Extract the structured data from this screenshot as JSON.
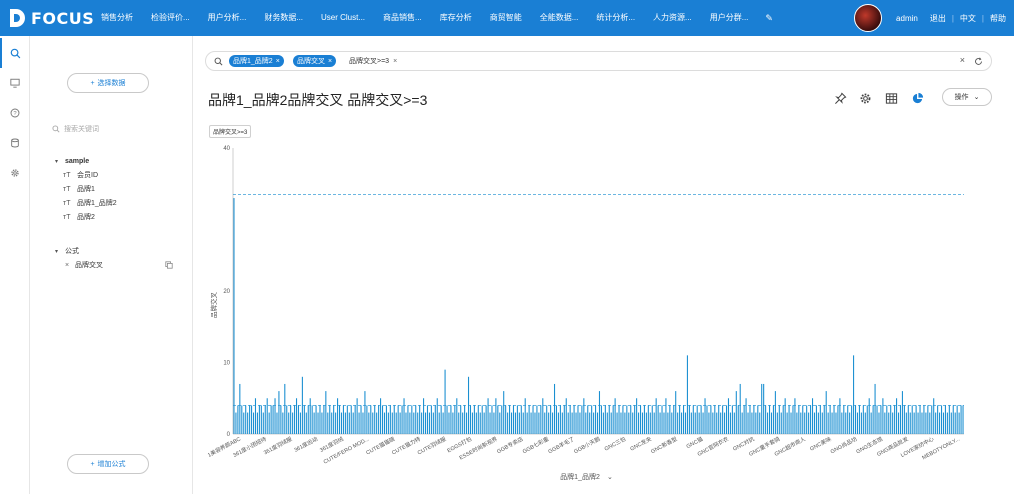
{
  "app": {
    "name": "FOCUS"
  },
  "nav": {
    "items": [
      "销售分析",
      "检验评价...",
      "用户分析...",
      "财务数据...",
      "User Clust...",
      "商品销售...",
      "库存分析",
      "商贸智能",
      "全能数据...",
      "统计分析...",
      "人力资源...",
      "用户分群..."
    ]
  },
  "user": {
    "name": "admin",
    "logout": "退出",
    "lang": "中文",
    "help": "帮助"
  },
  "sidebar": {
    "select_data": "选择数据",
    "search_placeholder": "搜索关键词",
    "dataset": {
      "name": "sample",
      "fields": [
        "会员ID",
        "品牌1",
        "品牌1_品牌2",
        "品牌2"
      ]
    },
    "formula": {
      "heading": "公式",
      "items": [
        "品牌交叉"
      ]
    },
    "add_formula": "增加公式"
  },
  "filter": {
    "chips": [
      "品牌1_品牌2",
      "品牌交叉"
    ],
    "condition": "品牌交叉>=3"
  },
  "page_title": "品牌1_品牌2品牌交叉 品牌交叉>=3",
  "toolbar": {
    "ops_label": "操作"
  },
  "accent_color": "#1a7fd4",
  "chart_data": {
    "type": "bar",
    "legend_tag": "品牌交叉>=3",
    "xlabel": "品牌1_品牌2",
    "ylabel": "品牌交叉",
    "ylim": [
      0,
      40
    ],
    "yticks": [
      0,
      10,
      20,
      40
    ],
    "grid": false,
    "reference_lines": [
      33.5,
      4
    ],
    "bar_color": "#1a8fd1",
    "category_labels": [
      "1美容养颜ABC",
      "361度小团招待",
      "361度羽绒服",
      "361度运动",
      "361度羽绒",
      "CUTE/FERO MOD...",
      "CUTE猫猫碗",
      "CUTE猫力特",
      "CUTE羽绒服",
      "EGGS打包",
      "ESSE时尚新视界",
      "GGB专卖店",
      "GGB七彩童",
      "GGB羊毛了",
      "GGB小天鹅",
      "GNC三包",
      "GNC发夹",
      "GNC新香型",
      "GNC猫",
      "GNC官网衣衣",
      "GNC对抗",
      "GNC童手套骑",
      "GNC超市商人",
      "GNC美味",
      "GNG尚品坊",
      "GNG生态馆",
      "GNG商品批发",
      "LOVE家纺中心",
      "MEBOTYONLY..."
    ],
    "values": [
      33,
      3,
      4,
      7,
      4,
      3,
      4,
      3,
      4,
      4,
      3,
      5,
      3,
      4,
      4,
      3,
      4,
      5,
      3,
      4,
      4,
      5,
      3,
      6,
      4,
      3,
      7,
      4,
      3,
      4,
      3,
      4,
      5,
      4,
      3,
      8,
      4,
      3,
      4,
      5,
      4,
      3,
      4,
      3,
      4,
      3,
      4,
      6,
      3,
      4,
      3,
      4,
      3,
      5,
      4,
      3,
      4,
      3,
      4,
      3,
      4,
      3,
      4,
      5,
      3,
      4,
      3,
      6,
      4,
      3,
      4,
      3,
      4,
      3,
      4,
      5,
      4,
      3,
      4,
      3,
      4,
      3,
      4,
      3,
      4,
      3,
      4,
      5,
      3,
      4,
      3,
      4,
      3,
      4,
      3,
      4,
      3,
      5,
      3,
      4,
      3,
      4,
      3,
      4,
      5,
      3,
      4,
      3,
      9,
      4,
      3,
      4,
      3,
      4,
      5,
      3,
      4,
      3,
      4,
      3,
      8,
      4,
      3,
      4,
      3,
      4,
      3,
      4,
      3,
      4,
      5,
      3,
      4,
      3,
      5,
      4,
      3,
      4,
      6,
      4,
      3,
      4,
      3,
      4,
      3,
      4,
      3,
      4,
      3,
      5,
      3,
      4,
      3,
      4,
      3,
      4,
      3,
      4,
      5,
      3,
      4,
      3,
      4,
      3,
      7,
      4,
      3,
      4,
      3,
      4,
      5,
      3,
      4,
      3,
      4,
      3,
      4,
      3,
      4,
      5,
      3,
      4,
      3,
      4,
      3,
      4,
      3,
      6,
      4,
      3,
      4,
      3,
      4,
      3,
      4,
      5,
      3,
      4,
      3,
      4,
      3,
      4,
      3,
      4,
      3,
      4,
      5,
      3,
      4,
      3,
      4,
      3,
      4,
      3,
      4,
      3,
      5,
      4,
      3,
      4,
      3,
      5,
      3,
      4,
      3,
      4,
      6,
      3,
      4,
      3,
      4,
      3,
      11,
      4,
      3,
      4,
      3,
      4,
      3,
      4,
      3,
      5,
      4,
      3,
      4,
      3,
      4,
      3,
      4,
      3,
      4,
      3,
      4,
      5,
      3,
      4,
      3,
      6,
      4,
      7,
      3,
      4,
      5,
      3,
      4,
      3,
      4,
      3,
      4,
      3,
      7,
      7,
      4,
      3,
      4,
      3,
      4,
      6,
      3,
      4,
      3,
      4,
      5,
      3,
      4,
      3,
      4,
      5,
      3,
      4,
      3,
      4,
      3,
      4,
      3,
      4,
      5,
      3,
      4,
      3,
      4,
      3,
      4,
      6,
      3,
      4,
      3,
      4,
      3,
      4,
      5,
      3,
      4,
      3,
      4,
      3,
      4,
      11,
      4,
      3,
      4,
      3,
      4,
      3,
      4,
      5,
      3,
      4,
      7,
      4,
      3,
      4,
      5,
      3,
      4,
      3,
      4,
      3,
      4,
      5,
      3,
      4,
      6,
      4,
      3,
      4,
      3,
      4,
      3,
      4,
      3,
      4,
      3,
      4,
      3,
      4,
      3,
      4,
      5,
      3,
      4,
      3,
      4,
      3,
      4,
      3,
      4,
      3,
      4,
      3,
      4,
      3,
      4,
      4
    ]
  }
}
